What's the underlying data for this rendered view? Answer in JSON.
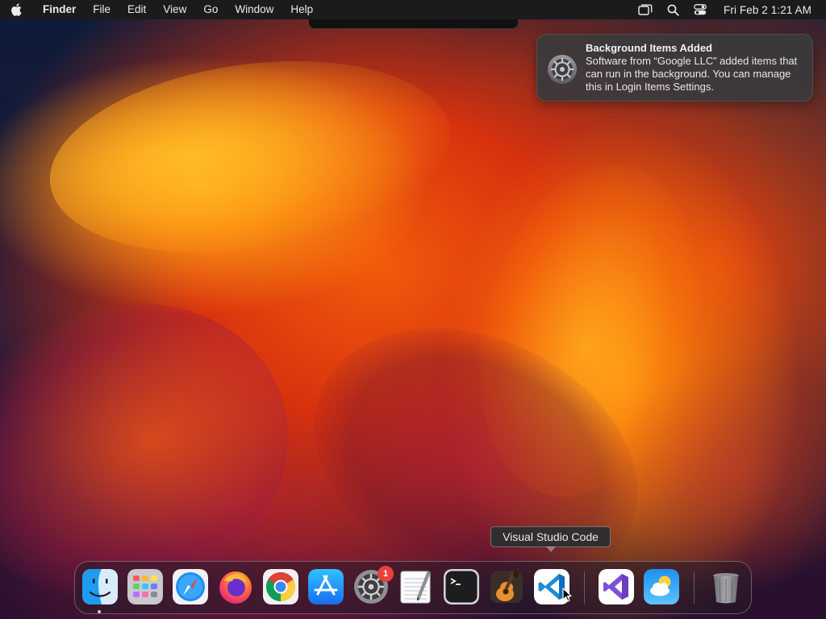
{
  "menubar": {
    "apple_icon": "apple-logo-icon",
    "app_name": "Finder",
    "menus": [
      "File",
      "Edit",
      "View",
      "Go",
      "Window",
      "Help"
    ],
    "status_icons": [
      "screen-mirroring-icon",
      "spotlight-search-icon",
      "control-center-icon"
    ],
    "clock": "Fri Feb 2  1:21 AM"
  },
  "notification": {
    "icon": "system-settings-gear-icon",
    "title": "Background Items Added",
    "body": "Software from “Google LLC” added items that can run in the background. You can manage this in Login Items Settings."
  },
  "tooltip": {
    "text": "Visual Studio Code"
  },
  "dock": {
    "apps": [
      {
        "name": "Finder",
        "icon": "finder-icon",
        "running": true
      },
      {
        "name": "Launchpad",
        "icon": "launchpad-icon"
      },
      {
        "name": "Safari",
        "icon": "safari-icon"
      },
      {
        "name": "Firefox",
        "icon": "firefox-icon"
      },
      {
        "name": "Google Chrome",
        "icon": "chrome-icon"
      },
      {
        "name": "App Store",
        "icon": "app-store-icon"
      },
      {
        "name": "System Settings",
        "icon": "system-settings-icon",
        "badge": "1"
      },
      {
        "name": "TextEdit",
        "icon": "textedit-icon"
      },
      {
        "name": "Terminal",
        "icon": "terminal-icon"
      },
      {
        "name": "GarageBand",
        "icon": "garageband-icon"
      },
      {
        "name": "Visual Studio Code",
        "icon": "vscode-icon"
      },
      {
        "name": "Visual Studio",
        "icon": "visual-studio-icon"
      },
      {
        "name": "Weather",
        "icon": "weather-icon"
      },
      {
        "name": "Trash",
        "icon": "trash-icon"
      }
    ]
  },
  "colors": {
    "menubar_bg": "#1b1b1d",
    "badge": "#e8403a",
    "vscode_blue": "#1f8ad2"
  }
}
